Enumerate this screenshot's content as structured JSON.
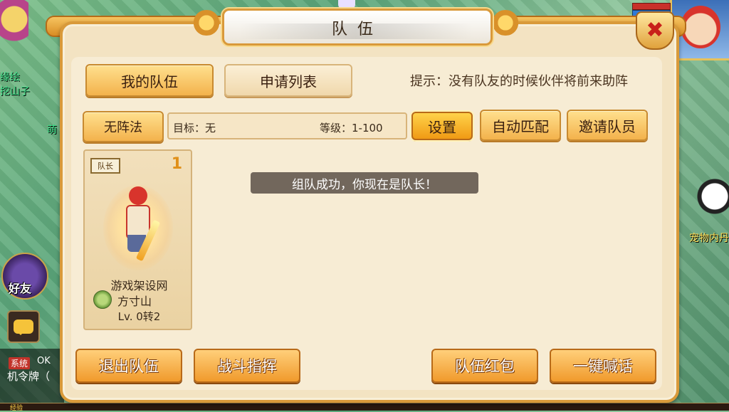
{
  "window": {
    "title": "队伍"
  },
  "tabs": {
    "my_team": "我的队伍",
    "apply_list": "申请列表"
  },
  "tip": "提示：没有队友的时候伙伴将前来助阵",
  "formation_button": "无阵法",
  "target": {
    "label": "目标：无",
    "level": "等级：1-100"
  },
  "actions": {
    "settings": "设置",
    "auto_match": "自动匹配",
    "invite": "邀请队员"
  },
  "member": {
    "badge": "队长",
    "slot": "1",
    "name": "游戏架设网",
    "sect": "方寸山",
    "level": "Lv. 0转2"
  },
  "toast": "组队成功，你现在是队长！",
  "bottom_buttons": {
    "leave": "退出队伍",
    "battle_command": "战斗指挥",
    "red_packet": "队伍红包",
    "shout": "一键喊话"
  },
  "world": {
    "npc_name_1": "缘绘",
    "npc_name_2": "挖山子",
    "npc_name_3": "萌",
    "friend_label": "好友",
    "pet_label": "宠物内丹",
    "chat_sys_tag": "系统",
    "chat_sys_text": "OK",
    "chat_line": "机令牌（",
    "exp_label": "经验"
  },
  "colors": {
    "panel_bg": "#f3e3c2",
    "gold_border": "#d99a3a",
    "close_x": "#c8201a"
  },
  "icons": [
    "close-icon",
    "chat-icon",
    "sect-icon",
    "friend-icon"
  ]
}
